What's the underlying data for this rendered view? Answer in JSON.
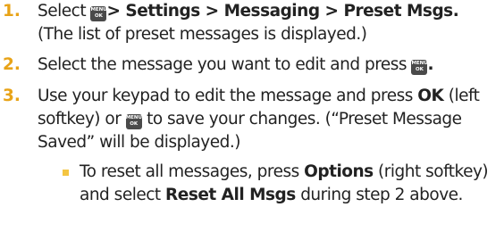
{
  "key_icon": {
    "line1": "MENU",
    "line2": "OK"
  },
  "colors": {
    "step_number": "#e8a317",
    "bullet": "#f4c542",
    "key_bg": "#4a4a4a"
  },
  "steps": [
    {
      "number": "1.",
      "p1_prefix": "Select ",
      "p1_bold": "> Settings > Messaging > Preset Msgs",
      "p1_suffix": ".",
      "line2": "(The list of preset messages is displayed.)"
    },
    {
      "number": "2.",
      "prefix": "Select the message you want to edit and press ",
      "suffix": "."
    },
    {
      "number": "3.",
      "p1_prefix": "Use your keypad to edit the message and press ",
      "p1_bold": "OK",
      "p1_suffix": " (left",
      "p2_prefix": "softkey) or ",
      "p2_suffix": " to save your changes. (“Preset Message",
      "p3": "Saved” will be displayed.)"
    }
  ],
  "subitem": {
    "p1_prefix": "To reset all messages, press ",
    "p1_bold": "Options",
    "p1_suffix": " (right softkey)",
    "p2_prefix": "and select ",
    "p2_bold": "Reset All Msgs",
    "p2_suffix": " during step 2 above."
  }
}
